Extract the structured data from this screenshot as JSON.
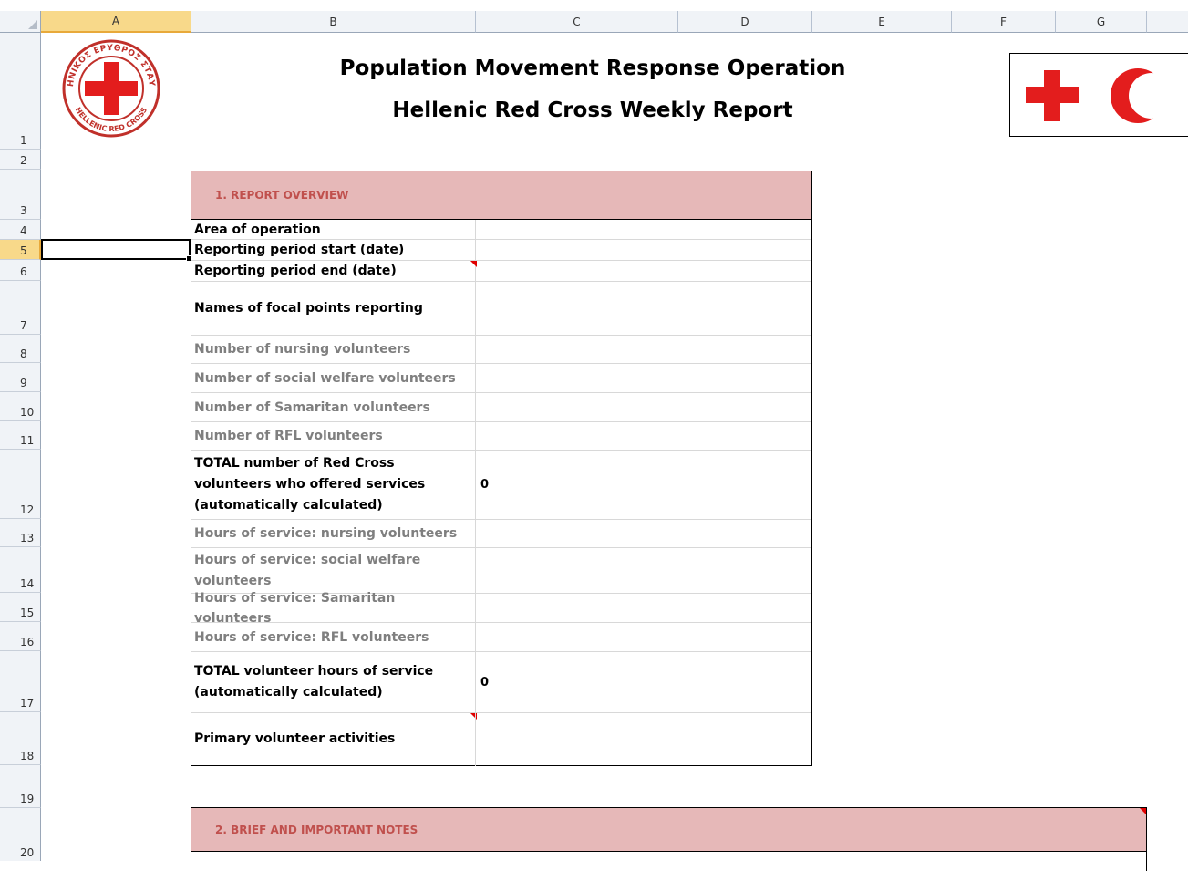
{
  "columns": [
    "A",
    "B",
    "C",
    "D",
    "E",
    "F",
    "G"
  ],
  "rows": [
    "1",
    "2",
    "3",
    "4",
    "5",
    "6",
    "7",
    "8",
    "9",
    "10",
    "11",
    "12",
    "13",
    "14",
    "15",
    "16",
    "17",
    "18",
    "19",
    "20"
  ],
  "selected_cell": "A5",
  "title": {
    "line1": "Population Movement Response Operation",
    "line2": "Hellenic Red Cross Weekly Report"
  },
  "logo_left": {
    "top_text": "ΕΛΛΗΝΙΚΟΣ ΕΡΥΘΡΟΣ ΣΤΑΥΡΟΣ",
    "bottom_text": "HELLENIC RED CROSS",
    "color": "#e31d1d"
  },
  "logo_right": {
    "color": "#e31d1d",
    "emblems": [
      "red-cross",
      "red-crescent"
    ]
  },
  "section1": {
    "header": "1. REPORT OVERVIEW",
    "rows": [
      {
        "label": "Area of operation",
        "value": "",
        "style": "bold"
      },
      {
        "label": "Reporting period start (date)",
        "value": "",
        "style": "bold"
      },
      {
        "label": "Reporting period end (date)",
        "value": "",
        "style": "bold"
      },
      {
        "label": "Names of focal points reporting",
        "value": "",
        "style": "bold"
      },
      {
        "label": "Number of nursing volunteers",
        "value": "",
        "style": "gray"
      },
      {
        "label": "Number of social welfare volunteers",
        "value": "",
        "style": "gray"
      },
      {
        "label": "Number of Samaritan volunteers",
        "value": "",
        "style": "gray"
      },
      {
        "label": "Number of RFL volunteers",
        "value": "",
        "style": "gray"
      },
      {
        "label": "TOTAL number of Red Cross volunteers who offered services (automatically calculated)",
        "value": "0",
        "style": "bold"
      },
      {
        "label": "Hours of service: nursing volunteers",
        "value": "",
        "style": "gray"
      },
      {
        "label": "Hours of service: social welfare volunteers",
        "value": "",
        "style": "gray"
      },
      {
        "label": "Hours of service: Samaritan volunteers",
        "value": "",
        "style": "gray"
      },
      {
        "label": "Hours of service: RFL volunteers",
        "value": "",
        "style": "gray"
      },
      {
        "label": "TOTAL volunteer hours of service (automatically calculated)",
        "value": "0",
        "style": "bold"
      },
      {
        "label": "Primary volunteer activities",
        "value": "",
        "style": "bold"
      }
    ]
  },
  "section2": {
    "header": "2. BRIEF AND IMPORTANT NOTES"
  },
  "colors": {
    "section_header_bg": "#e6b8b8",
    "section_header_text": "#c0504d",
    "gray_text": "#7f7f7f",
    "selection_highlight": "#f8d98a"
  }
}
